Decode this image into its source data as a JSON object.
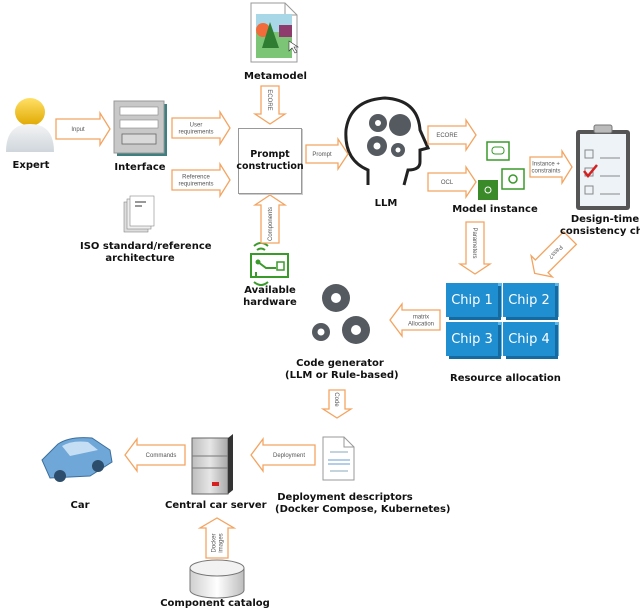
{
  "diagram": {
    "nodes": {
      "expert": "Expert",
      "interface": "Interface",
      "iso": [
        "ISO standard/reference",
        "architecture"
      ],
      "metamodel": "Metamodel",
      "prompt": [
        "Prompt",
        "construction"
      ],
      "hardware": [
        "Available",
        "hardware"
      ],
      "llm": "LLM",
      "model_instance": "Model instance",
      "consistency": [
        "Design-time",
        "consistency check"
      ],
      "resource_allocation": "Resource allocation",
      "code_generator": [
        "Code generator",
        "(LLM or Rule-based)"
      ],
      "deployment": [
        "Deployment descriptors",
        "(Docker Compose, Kubernetes)"
      ],
      "server": "Central car server",
      "car": "Car",
      "catalog": "Component catalog"
    },
    "chips": [
      "Chip 1",
      "Chip 2",
      "Chip 3",
      "Chip 4"
    ],
    "edges": {
      "input": "Input",
      "user_req": [
        "User",
        "requirements"
      ],
      "ref_req": [
        "Reference",
        "requirements"
      ],
      "ecore_meta": "ECORE",
      "components": "Components",
      "prompt": "Prompt",
      "ecore_llm": "ECORE",
      "ocl": "OCL",
      "instance_constraints": [
        "Instance +",
        "constraints"
      ],
      "parameters": "Parameters",
      "pass": "Pass?",
      "allocation": [
        "Allocation",
        "matrix"
      ],
      "code": "Code",
      "deployment": "Deployment",
      "commands": "Commands",
      "docker_images": [
        "Docker",
        "images"
      ]
    },
    "colors": {
      "arrow_stroke": "#f4a460",
      "chip_blue": "#1f8fd2",
      "hardware_green": "#3a9a2a",
      "gear_gray": "#5a5e66",
      "check_red": "#d62020"
    }
  }
}
